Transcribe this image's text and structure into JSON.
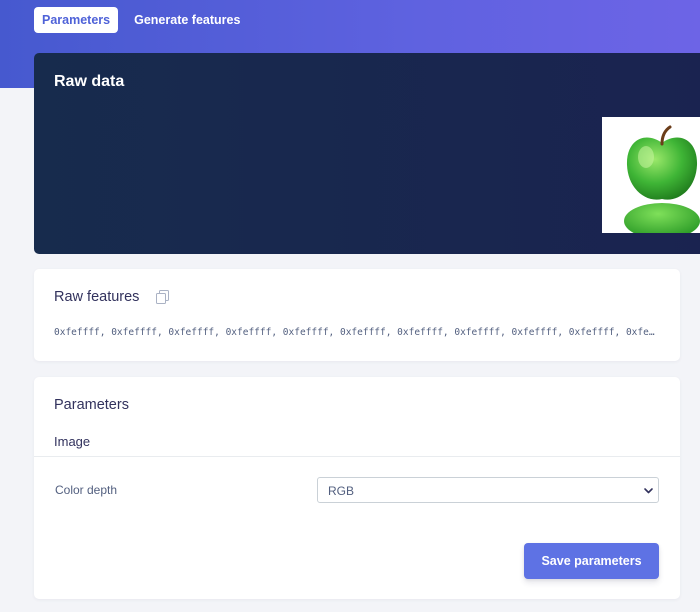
{
  "tabs": [
    {
      "label": "Parameters",
      "active": true
    },
    {
      "label": "Generate features",
      "active": false
    }
  ],
  "raw_data": {
    "title": "Raw data",
    "image_description_icon": "green-apple-image"
  },
  "raw_features": {
    "title": "Raw features",
    "copy_icon": "copy-icon",
    "values": "0xfeffff, 0xfeffff, 0xfeffff, 0xfeffff, 0xfeffff, 0xfeffff, 0xfeffff, 0xfeffff, 0xfeffff, 0xfeffff, 0xfeffff…"
  },
  "parameters": {
    "title": "Parameters",
    "section": "Image",
    "color_depth_label": "Color depth",
    "color_depth_value": "RGB",
    "save_label": "Save parameters"
  },
  "colors": {
    "accent": "#5e72e4",
    "header_gradient_start": "#4659cf",
    "header_gradient_end": "#6d64e6",
    "dark_card": "#172b4d",
    "apple_green": "#3fb536"
  }
}
